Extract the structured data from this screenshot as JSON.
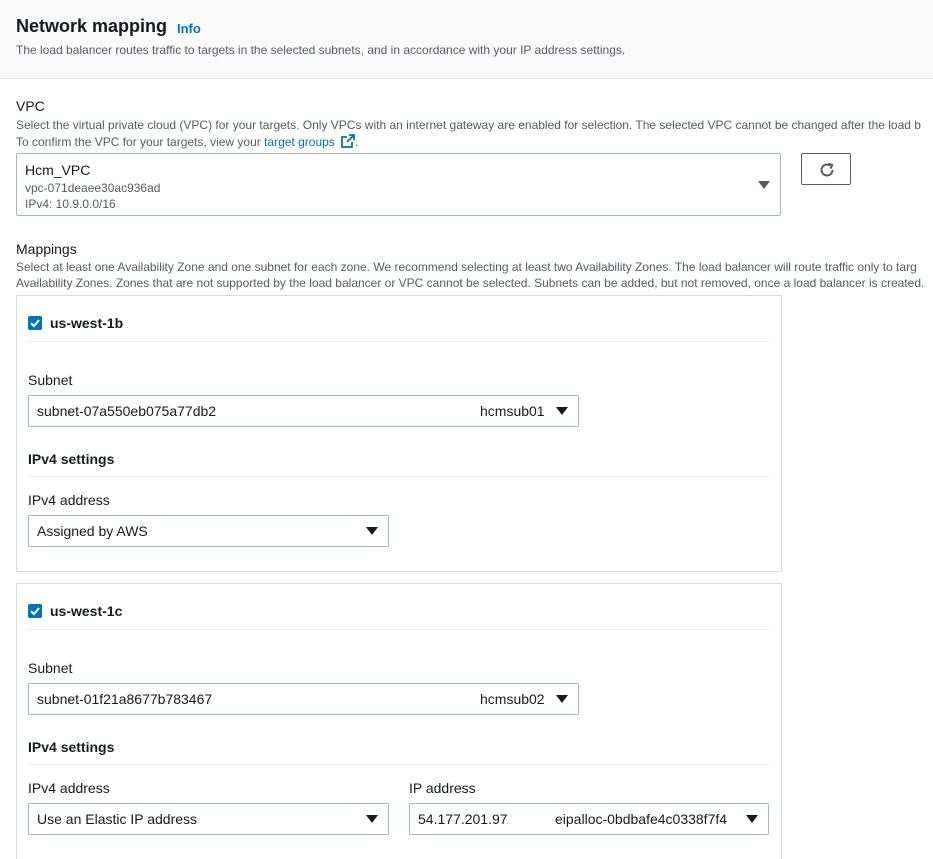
{
  "header": {
    "title": "Network mapping",
    "info_label": "Info",
    "description": "The load balancer routes traffic to targets in the selected subnets, and in accordance with your IP address settings."
  },
  "vpc": {
    "label": "VPC",
    "description_line1": "Select the virtual private cloud (VPC) for your targets. Only VPCs with an internet gateway are enabled for selection. The selected VPC cannot be changed after the load b",
    "description_line2_prefix": "To confirm the VPC for your targets, view your ",
    "target_groups_link": "target groups",
    "description_line2_suffix": ".",
    "selected_name": "Hcm_VPC",
    "selected_id": "vpc-071deaee30ac936ad",
    "selected_cidr": "IPv4: 10.9.0.0/16",
    "refresh_icon": "refresh-icon"
  },
  "mappings": {
    "label": "Mappings",
    "description_line1": "Select at least one Availability Zone and one subnet for each zone. We recommend selecting at least two Availability Zones. The load balancer will route traffic only to targ",
    "description_line2": "Availability Zones. Zones that are not supported by the load balancer or VPC cannot be selected. Subnets can be added, but not removed, once a load balancer is created.",
    "zones": [
      {
        "name": "us-west-1b",
        "checked": true,
        "subnet_label": "Subnet",
        "subnet_id": "subnet-07a550eb075a77db2",
        "subnet_name": "hcmsub01",
        "ipv4_settings_label": "IPv4 settings",
        "ipv4_address_label": "IPv4 address",
        "ipv4_address_value": "Assigned by AWS"
      },
      {
        "name": "us-west-1c",
        "checked": true,
        "subnet_label": "Subnet",
        "subnet_id": "subnet-01f21a8677b783467",
        "subnet_name": "hcmsub02",
        "ipv4_settings_label": "IPv4 settings",
        "ipv4_address_label": "IPv4 address",
        "ipv4_address_value": "Use an Elastic IP address",
        "ip_address_label": "IP address",
        "ip_address_value": "54.177.201.97",
        "eip_alloc": "eipalloc-0bdbafe4c0338f7f4"
      }
    ]
  },
  "colors": {
    "link": "#0073bb",
    "checkbox": "#0073bb",
    "border": "#aab7b8",
    "text": "#16191f",
    "muted": "#545b64"
  }
}
